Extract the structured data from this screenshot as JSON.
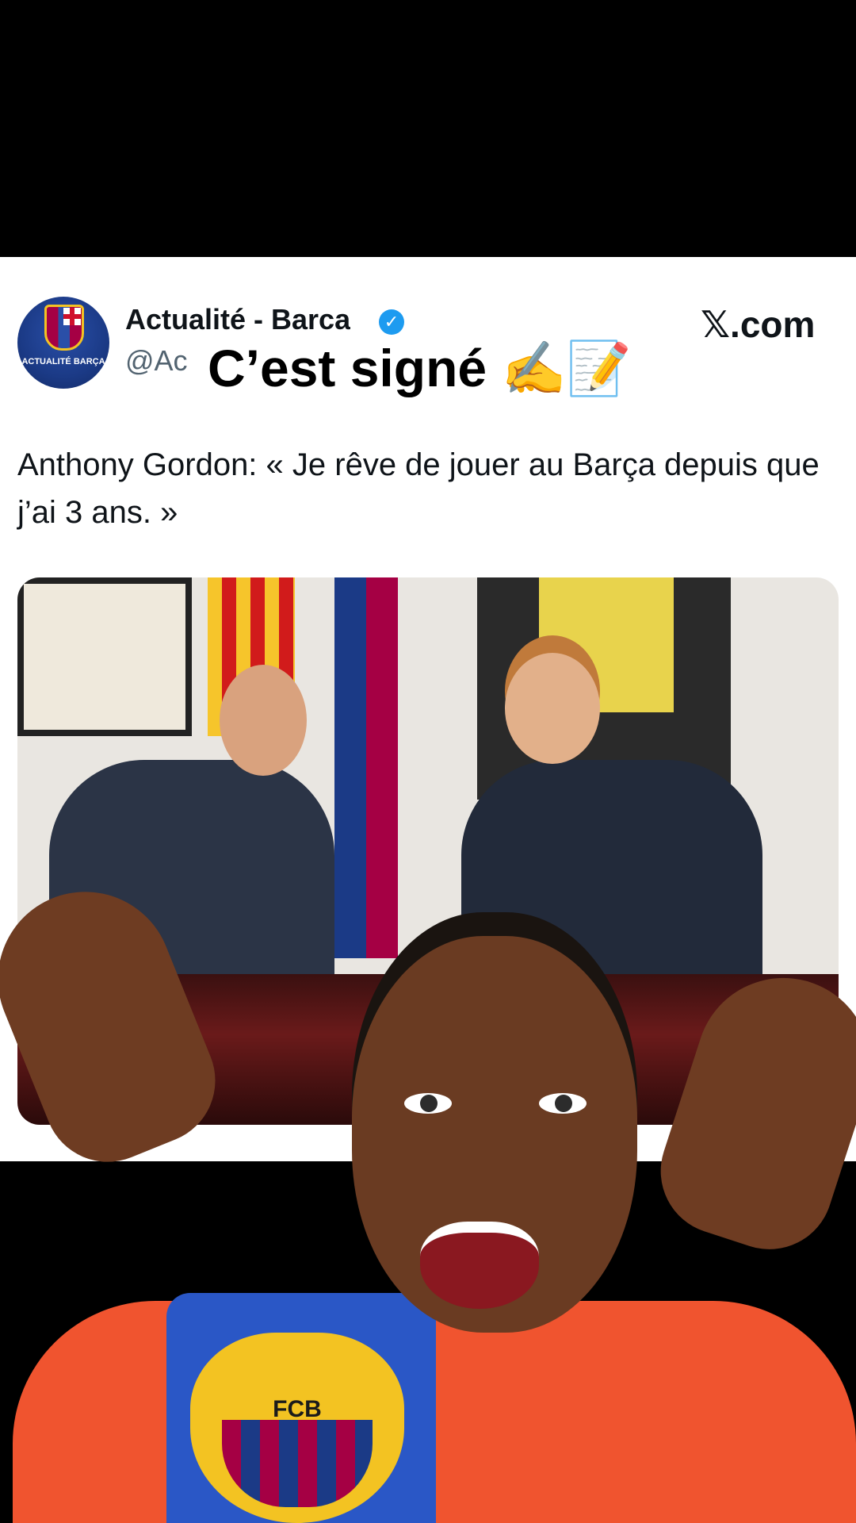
{
  "post": {
    "account_name": "Actualité - Barca",
    "handle": "@Ac",
    "verified_glyph": "✓",
    "source": "𝕏.com",
    "avatar_text": "ACTUALITÉ BARÇA",
    "text": "Anthony Gordon: « Je rêve de jouer au Barça depuis que j’ai 3 ans. »"
  },
  "overlay": {
    "caption": "C’est signé ✍️📝"
  },
  "streamer": {
    "badge_text": "FCB"
  },
  "colors": {
    "verified_blue": "#1d9bf0",
    "text_primary": "#0f1419",
    "text_secondary": "#536471",
    "barca_blue": "#1b3a86",
    "barca_red": "#a50044",
    "barca_gold": "#f3c322"
  }
}
